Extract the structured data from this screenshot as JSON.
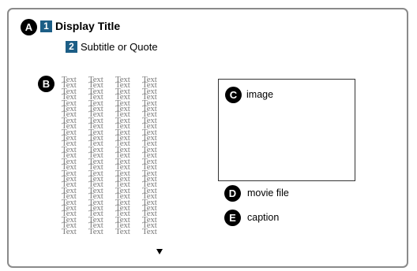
{
  "markers": {
    "a": "A",
    "b": "B",
    "c": "C",
    "d": "D",
    "e": "E"
  },
  "numbers": {
    "one": "1",
    "two": "2"
  },
  "title": "Display Title",
  "subtitle": "Subtitle or Quote",
  "body_text": {
    "word": "Text",
    "columns": 4,
    "rows": 27
  },
  "image_label": "image",
  "movie_label": "movie file",
  "caption_label": "caption",
  "more_indicator_icon": "down-triangle-icon"
}
